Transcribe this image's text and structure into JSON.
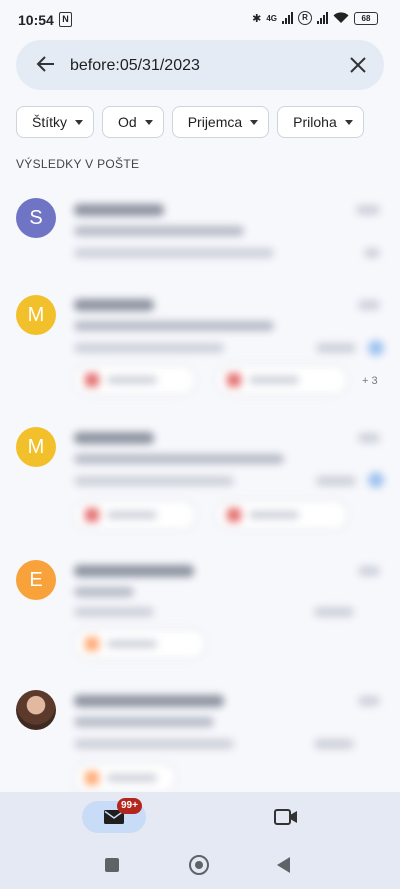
{
  "status_bar": {
    "time": "10:54",
    "nfc": "N",
    "network": "4G",
    "roaming": "R",
    "battery": "68"
  },
  "search": {
    "query": "before:05/31/2023"
  },
  "filters": [
    {
      "label": "Štítky"
    },
    {
      "label": "Od"
    },
    {
      "label": "Prijemca"
    },
    {
      "label": "Priloha"
    }
  ],
  "section_label": "VÝSLEDKY V POŠTE",
  "emails": [
    {
      "avatar_letter": "S",
      "avatar_color": "#6f74c5"
    },
    {
      "avatar_letter": "M",
      "avatar_color": "#f2c02b",
      "more_attachments": "+ 3"
    },
    {
      "avatar_letter": "M",
      "avatar_color": "#f2c02b"
    },
    {
      "avatar_letter": "E",
      "avatar_color": "#f7a23a"
    },
    {
      "avatar_letter": "",
      "avatar_color": "#6b4a3a"
    }
  ],
  "bottom_nav": {
    "mail_badge": "99+",
    "icons": [
      "mail-icon",
      "meet-video-icon"
    ]
  },
  "colors": {
    "accent_pill": "#c8dcf7",
    "badge": "#b3261e",
    "search_bg": "#e5ebf5"
  }
}
